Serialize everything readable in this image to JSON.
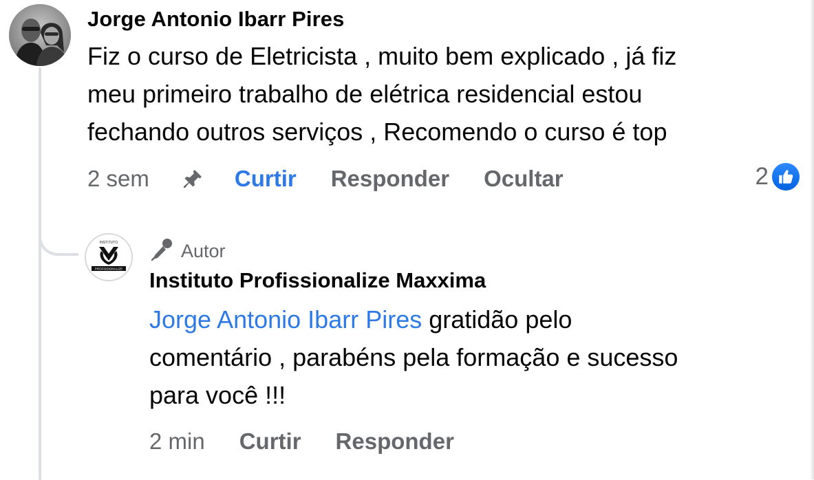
{
  "comment": {
    "author": "Jorge Antonio Ibarr Pires",
    "text_lines": [
      "Fiz o curso de Eletricista , muito bem explicado , já fiz",
      "meu primeiro trabalho de elétrica residencial estou",
      "fechando outros serviços , Recomendo o curso é top"
    ],
    "time": "2 sem",
    "actions": {
      "like": "Curtir",
      "reply": "Responder",
      "hide": "Ocultar"
    },
    "reaction_count": "2",
    "pin_icon": "pin-icon",
    "reaction_icon": "like-icon"
  },
  "reply": {
    "badge": "Autor",
    "badge_icon": "microphone-icon",
    "author": "Instituto Profissionalize Maxxima",
    "mention": "Jorge Antonio Ibarr Pires",
    "text_lines": [
      " gratidão pelo",
      "comentário , parabéns pela formação e sucesso",
      "para você !!!"
    ],
    "time": "2 min",
    "actions": {
      "like": "Curtir",
      "reply": "Responder"
    }
  },
  "colors": {
    "link_blue": "#2d7ae6",
    "secondary_text": "#65676b",
    "primary_text": "#050505",
    "like_blue": "#0866ff"
  }
}
